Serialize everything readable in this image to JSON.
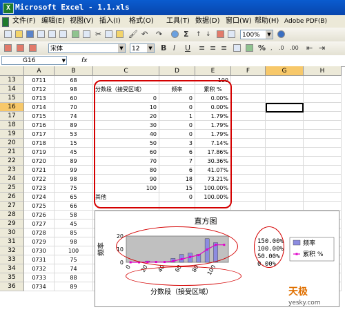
{
  "window": {
    "title": "Microsoft Excel - 1.1.xls"
  },
  "menu": [
    "文件(F)",
    "编辑(E)",
    "视图(V)",
    "插入(I)",
    "格式(O)",
    "工具(T)",
    "数据(D)",
    "窗口(W)",
    "帮助(H)",
    "Adobe PDF(B)"
  ],
  "toolbar": {
    "zoom": "100%",
    "sigma": "Σ",
    "percent": "%"
  },
  "format_toolbar": {
    "font": "宋体",
    "size": "12",
    "bold": "B",
    "italic": "I",
    "underline": "U"
  },
  "formula_bar": {
    "name_box": "G16",
    "fx": "fx",
    "value": ""
  },
  "columns": [
    "A",
    "B",
    "C",
    "D",
    "E",
    "F",
    "G",
    "H"
  ],
  "rows": [
    {
      "n": "13",
      "a": "0711",
      "b": "68",
      "c": "",
      "d": "",
      "e": "100"
    },
    {
      "n": "14",
      "a": "0712",
      "b": "98",
      "c": "分数段（接受区域）",
      "d": "频率",
      "e": "累积 %"
    },
    {
      "n": "15",
      "a": "0713",
      "b": "60",
      "c": "0",
      "d": "0",
      "e": "0.00%"
    },
    {
      "n": "16",
      "a": "0714",
      "b": "70",
      "c": "10",
      "d": "0",
      "e": "0.00%"
    },
    {
      "n": "17",
      "a": "0715",
      "b": "74",
      "c": "20",
      "d": "1",
      "e": "1.79%"
    },
    {
      "n": "18",
      "a": "0716",
      "b": "89",
      "c": "30",
      "d": "0",
      "e": "1.79%"
    },
    {
      "n": "19",
      "a": "0717",
      "b": "53",
      "c": "40",
      "d": "0",
      "e": "1.79%"
    },
    {
      "n": "20",
      "a": "0718",
      "b": "15",
      "c": "50",
      "d": "3",
      "e": "7.14%"
    },
    {
      "n": "21",
      "a": "0719",
      "b": "45",
      "c": "60",
      "d": "6",
      "e": "17.86%"
    },
    {
      "n": "22",
      "a": "0720",
      "b": "89",
      "c": "70",
      "d": "7",
      "e": "30.36%"
    },
    {
      "n": "23",
      "a": "0721",
      "b": "99",
      "c": "80",
      "d": "6",
      "e": "41.07%"
    },
    {
      "n": "24",
      "a": "0722",
      "b": "98",
      "c": "90",
      "d": "18",
      "e": "73.21%"
    },
    {
      "n": "25",
      "a": "0723",
      "b": "75",
      "c": "100",
      "d": "15",
      "e": "100.00%"
    },
    {
      "n": "26",
      "a": "0724",
      "b": "65",
      "c": "其他",
      "d": "0",
      "e": "100.00%"
    },
    {
      "n": "27",
      "a": "0725",
      "b": "66",
      "c": "",
      "d": "",
      "e": ""
    },
    {
      "n": "28",
      "a": "0726",
      "b": "58",
      "c": "",
      "d": "",
      "e": ""
    },
    {
      "n": "29",
      "a": "0727",
      "b": "45",
      "c": "",
      "d": "",
      "e": ""
    },
    {
      "n": "30",
      "a": "0728",
      "b": "85",
      "c": "",
      "d": "",
      "e": ""
    },
    {
      "n": "31",
      "a": "0729",
      "b": "98",
      "c": "",
      "d": "",
      "e": ""
    },
    {
      "n": "32",
      "a": "0730",
      "b": "100",
      "c": "",
      "d": "",
      "e": ""
    },
    {
      "n": "33",
      "a": "0731",
      "b": "75",
      "c": "",
      "d": "",
      "e": ""
    },
    {
      "n": "34",
      "a": "0732",
      "b": "74",
      "c": "",
      "d": "",
      "e": ""
    },
    {
      "n": "35",
      "a": "0733",
      "b": "88",
      "c": "",
      "d": "",
      "e": ""
    },
    {
      "n": "36",
      "a": "0734",
      "b": "89",
      "c": "",
      "d": "",
      "e": ""
    }
  ],
  "chart_data": {
    "type": "bar",
    "title": "直方图",
    "xlabel": "分数段（接受区域）",
    "ylabel": "频率",
    "categories": [
      "0",
      "10",
      "20",
      "30",
      "40",
      "50",
      "60",
      "70",
      "80",
      "90",
      "100",
      "其他"
    ],
    "x_tick_labels": [
      "0",
      "20",
      "40",
      "60",
      "80",
      "100"
    ],
    "y_ticks": [
      "0",
      "10",
      "20"
    ],
    "y2_ticks": [
      "150.00%",
      "100.00%",
      "50.00%",
      "0.00%"
    ],
    "ylim": [
      0,
      20
    ],
    "y2lim": [
      0,
      150
    ],
    "series": [
      {
        "name": "频率",
        "kind": "bar",
        "values": [
          0,
          0,
          1,
          0,
          0,
          3,
          6,
          7,
          6,
          18,
          15,
          0
        ],
        "color": "#8c8ce0"
      },
      {
        "name": "累积 %",
        "kind": "line",
        "values": [
          0,
          0,
          1.79,
          1.79,
          1.79,
          7.14,
          17.86,
          30.36,
          41.07,
          73.21,
          100,
          100
        ],
        "color": "#e000c8"
      }
    ],
    "plot_background": "#c0c0c0",
    "legend_position": "right"
  },
  "watermark": {
    "brand": "天极",
    "site": "yesky.com"
  }
}
